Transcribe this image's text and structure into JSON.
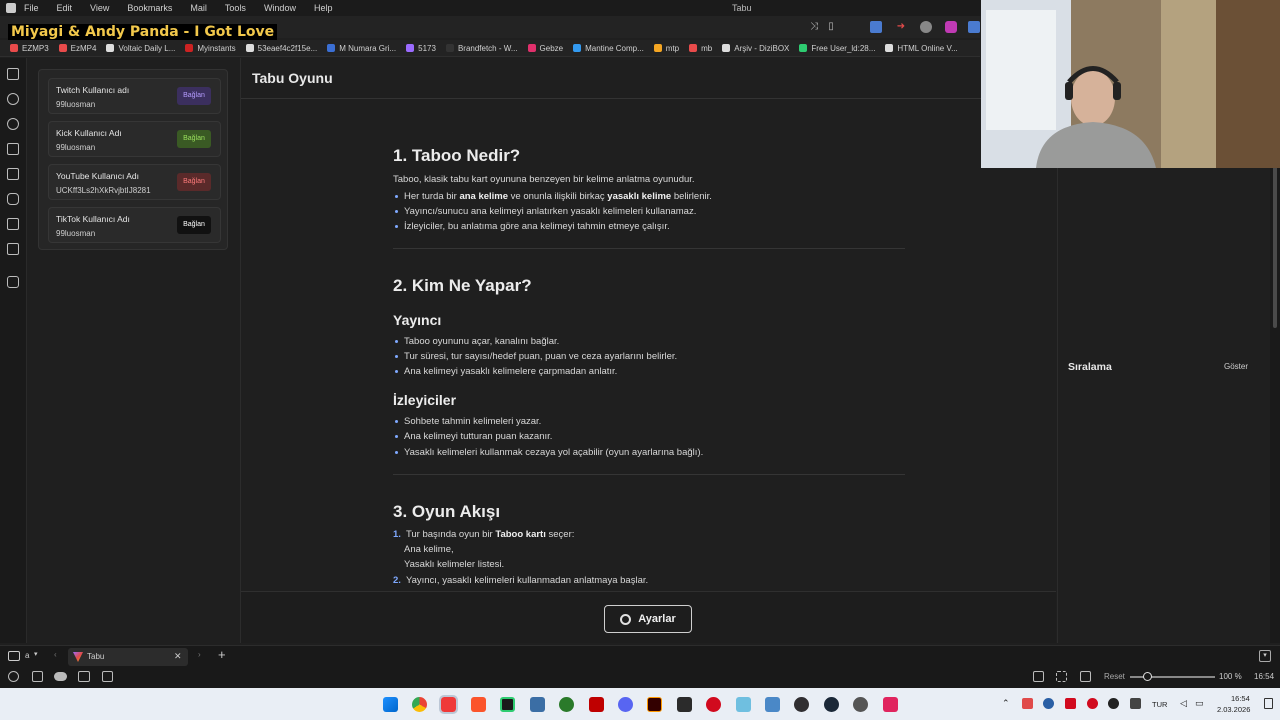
{
  "window": {
    "title": "Tabu",
    "menu": [
      "File",
      "Edit",
      "View",
      "Bookmarks",
      "Mail",
      "Tools",
      "Window",
      "Help"
    ],
    "url_fragment": "oo"
  },
  "overlay": {
    "song": "Miyagi & Andy Panda - I Got Love"
  },
  "bookmarks": [
    {
      "label": "EZMP3",
      "color": "#e94b4b"
    },
    {
      "label": "EzMP4",
      "color": "#e94b4b"
    },
    {
      "label": "Voltaic Daily L...",
      "color": "#dddddd"
    },
    {
      "label": "Myinstants",
      "color": "#cc2222"
    },
    {
      "label": "53eaef4c2f15e...",
      "color": "#dddddd"
    },
    {
      "label": "M Numara Gri...",
      "color": "#3b6fd4"
    },
    {
      "label": "5173",
      "color": "#9b6bff"
    },
    {
      "label": "Brandfetch - W...",
      "color": "#333333"
    },
    {
      "label": "Gebze",
      "color": "#e1306c"
    },
    {
      "label": "Mantine Comp...",
      "color": "#339af0"
    },
    {
      "label": "mtp",
      "color": "#f5a623"
    },
    {
      "label": "mb",
      "color": "#e94b4b"
    },
    {
      "label": "Arşiv - DiziBOX",
      "color": "#dddddd"
    },
    {
      "label": "Free User_ld:28...",
      "color": "#2ecc71"
    },
    {
      "label": "HTML Online V...",
      "color": "#dddddd"
    }
  ],
  "connections": [
    {
      "label": "Twitch Kullanıcı adı",
      "value": "99luosman",
      "button": "Bağlan",
      "btn_bg": "#3b2f5e",
      "btn_fg": "#b59cff"
    },
    {
      "label": "Kick Kullanıcı Adı",
      "value": "99luosman",
      "button": "Bağlan",
      "btn_bg": "#3a5a24",
      "btn_fg": "#9be15d"
    },
    {
      "label": "YouTube Kullanıcı Adı",
      "value": "UCKff3Ls2hXkRvjbtIJ8281",
      "button": "Bağlan",
      "btn_bg": "#5a2a2a",
      "btn_fg": "#ff7b7b"
    },
    {
      "label": "TikTok Kullanıcı Adı",
      "value": "99luosman",
      "button": "Bağlan",
      "btn_bg": "#111111",
      "btn_fg": "#ffffff"
    }
  ],
  "main": {
    "title": "Tabu Oyunu",
    "s1": {
      "heading": "1. Taboo Nedir?",
      "intro": "Taboo, klasik tabu kart oyununa benzeyen bir kelime anlatma oyunudur.",
      "b1_pre": "Her turda bir ",
      "b1_bold1": "ana kelime",
      "b1_mid": " ve onunla ilişkili birkaç ",
      "b1_bold2": "yasaklı kelime",
      "b1_post": " belirlenir.",
      "b2": "Yayıncı/sunucu ana kelimeyi anlatırken yasaklı kelimeleri kullanamaz.",
      "b3": "İzleyiciler, bu anlatıma göre ana kelimeyi tahmin etmeye çalışır."
    },
    "s2": {
      "heading": "2. Kim Ne Yapar?",
      "sub1": "Yayıncı",
      "sub1_items": [
        "Taboo oyununu açar, kanalını bağlar.",
        "Tur süresi, tur sayısı/hedef puan, puan ve ceza ayarlarını belirler.",
        "Ana kelimeyi yasaklı kelimelere çarpmadan anlatır."
      ],
      "sub2": "İzleyiciler",
      "sub2_items": [
        "Sohbete tahmin kelimeleri yazar.",
        "Ana kelimeyi tutturan puan kazanır.",
        "Yasaklı kelimeleri kullanmak cezaya yol açabilir (oyun ayarlarına bağlı)."
      ]
    },
    "s3": {
      "heading": "3. Oyun Akışı",
      "n1_num": "1.",
      "n1_pre": "Tur başında oyun bir ",
      "n1_bold": "Taboo kartı",
      "n1_post": " seçer:",
      "sub_items": [
        "Ana kelime,",
        "Yasaklı kelimeler listesi."
      ],
      "n2_num": "2.",
      "n2": "Yayıncı, yasaklı kelimeleri kullanmadan anlatmaya başlar."
    },
    "settings_button": "Ayarlar"
  },
  "ranking": {
    "title": "Sıralama",
    "toggle": "Göster"
  },
  "tabs": {
    "workspace": "a",
    "tab_title": "Tabu"
  },
  "status": {
    "reset": "Reset",
    "zoom": "100 %",
    "time": "16:54"
  },
  "taskbar": {
    "lang": "TUR",
    "clock_time": "16:54",
    "clock_date": "2.03.2026"
  }
}
